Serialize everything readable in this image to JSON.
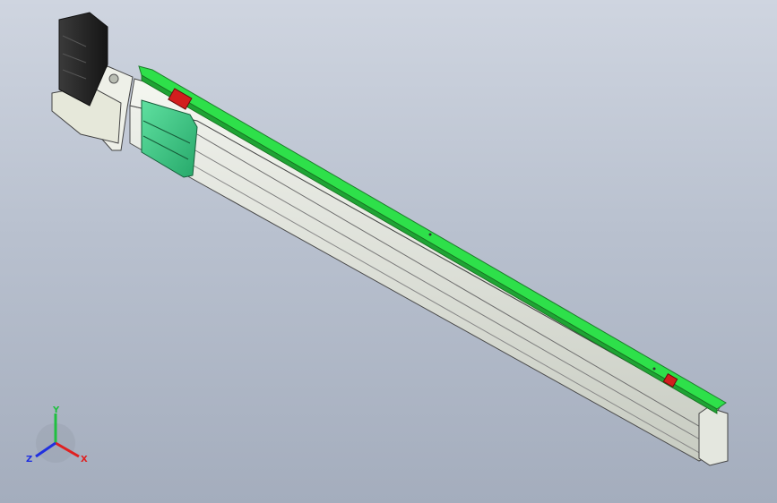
{
  "viewport": {
    "background_top": "#cfd5e0",
    "background_bottom": "#a4adbd"
  },
  "model": {
    "rail_color": "#2ee04a",
    "body_color": "#e6e9e1",
    "carriage_color": "#3fd08a",
    "motor_color": "#2a2a2a",
    "stop_color": "#d21e1e"
  },
  "triad": {
    "x_label": "X",
    "y_label": "Y",
    "z_label": "Z",
    "x_color": "#e02020",
    "y_color": "#20c040",
    "z_color": "#2030e0"
  }
}
